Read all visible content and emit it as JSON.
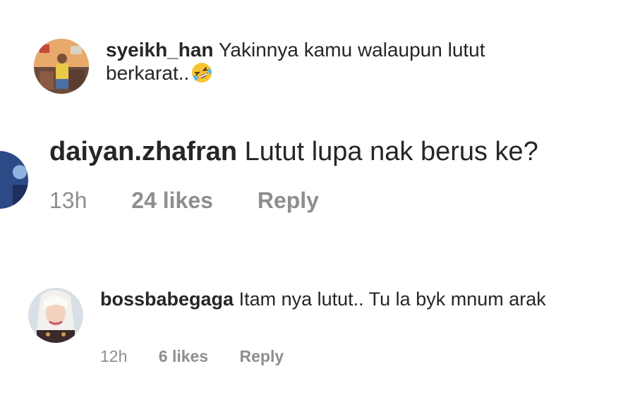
{
  "comments": [
    {
      "username": "syeikh_han",
      "text": "Yakinnya kamu walaupun lutut berkarat..",
      "emoji": "rolling-on-floor-laughing-emoji"
    },
    {
      "username": "daiyan.zhafran",
      "text": "Lutut lupa nak berus ke?",
      "time": "13h",
      "likes": "24 likes",
      "reply": "Reply"
    },
    {
      "username": "bossbabegaga",
      "text": "Itam nya lutut.. Tu la byk mnum arak",
      "time": "12h",
      "likes": "6 likes",
      "reply": "Reply"
    }
  ]
}
